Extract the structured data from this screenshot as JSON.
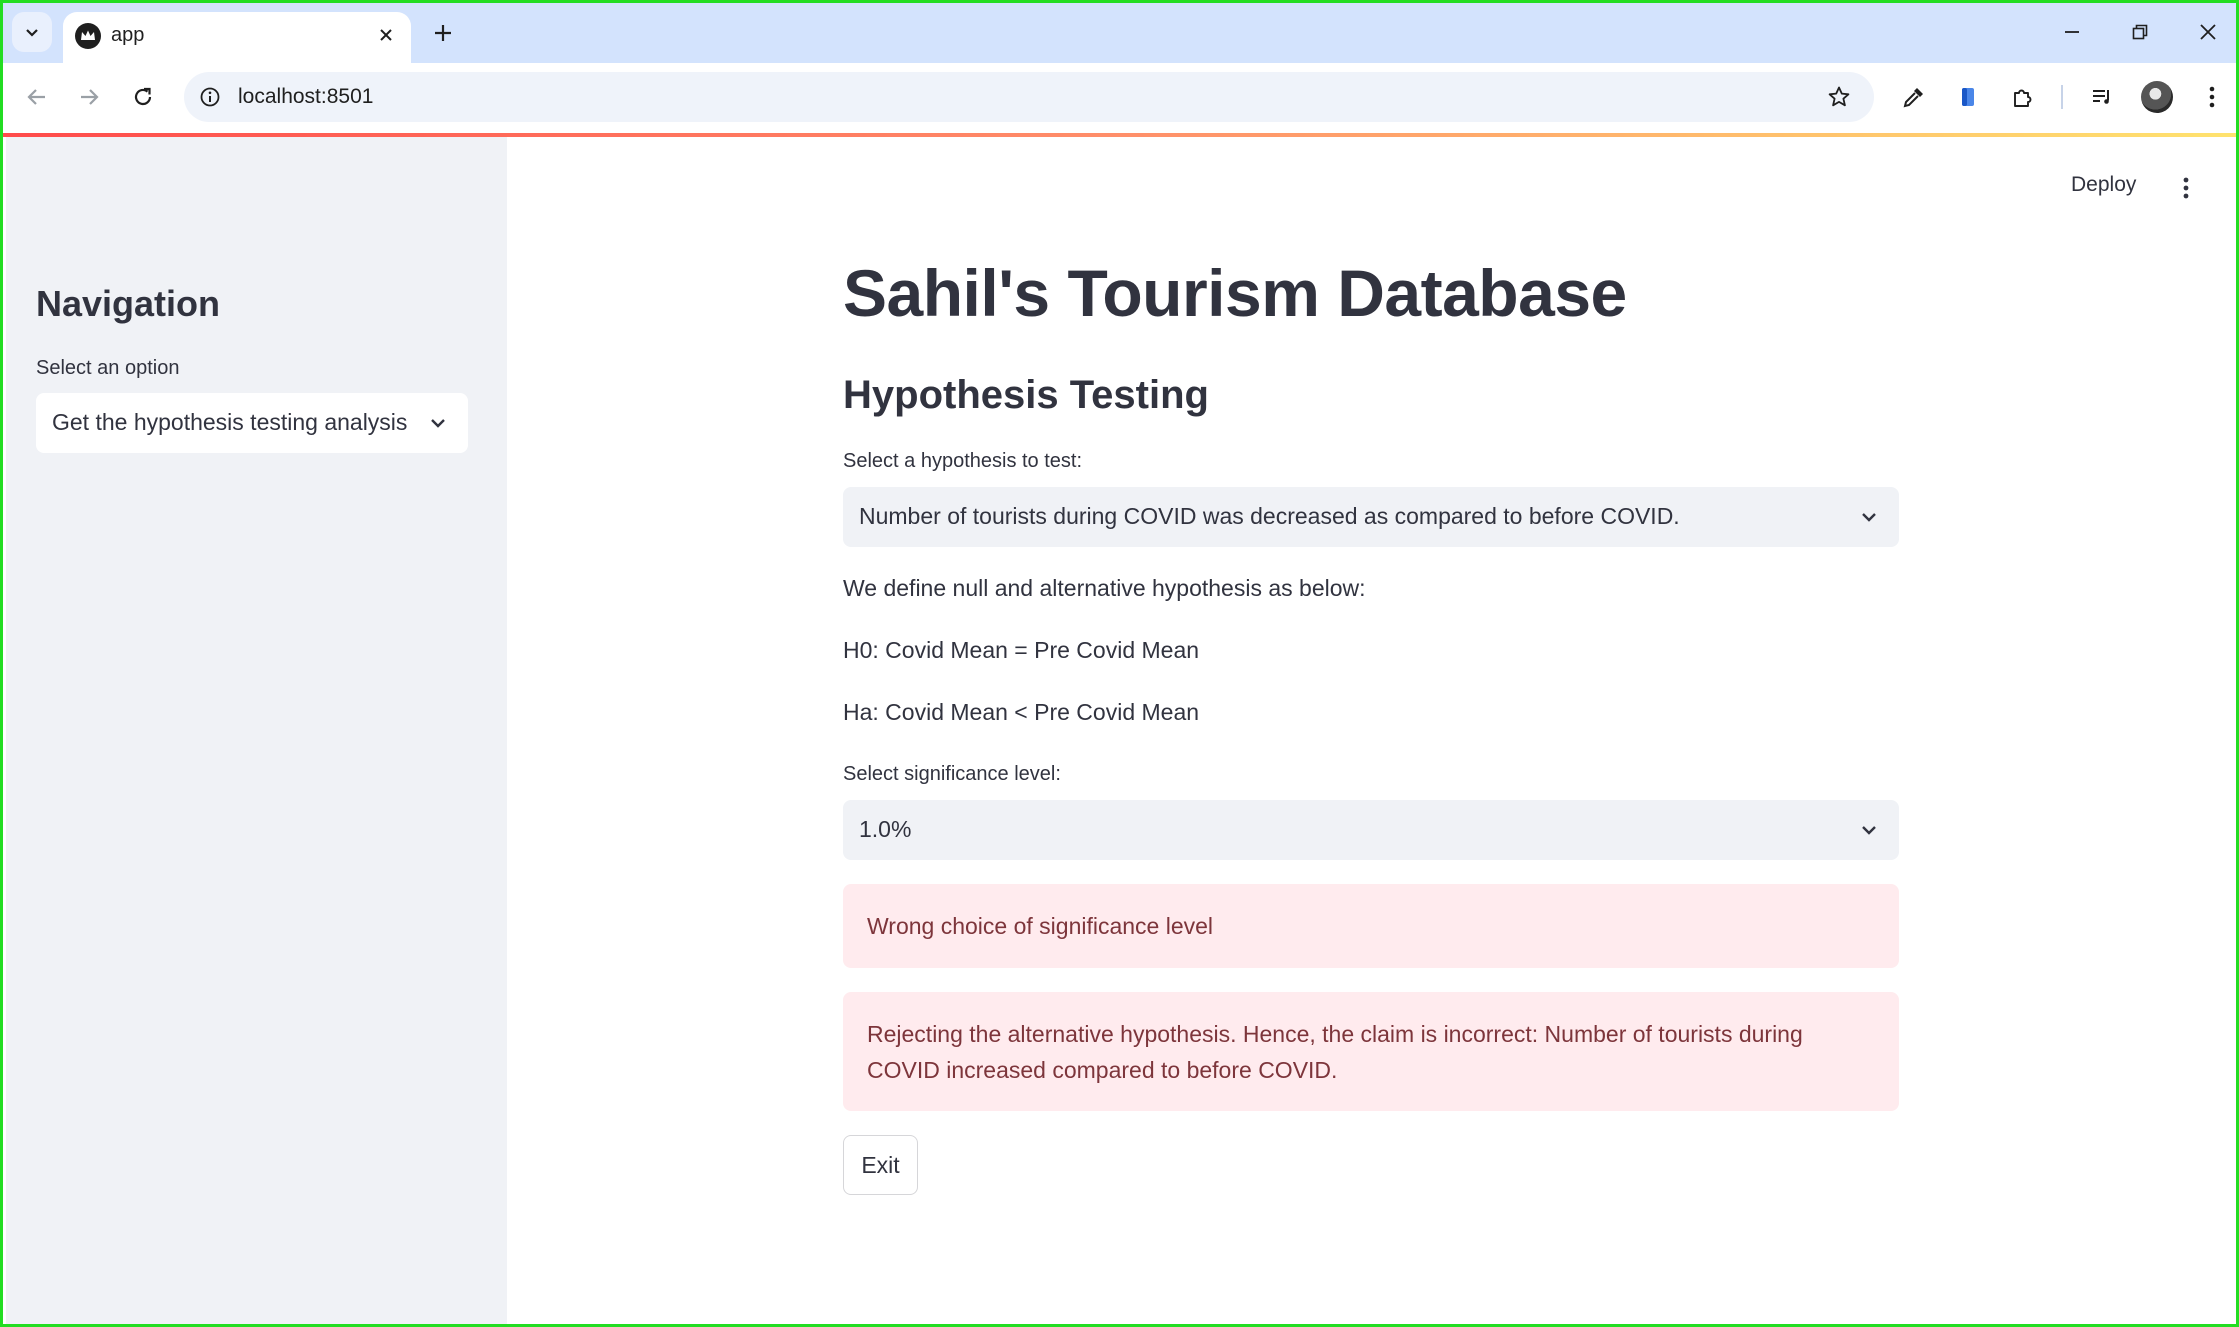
{
  "browser": {
    "tab_title": "app",
    "url": "localhost:8501"
  },
  "app": {
    "deploy_label": "Deploy",
    "sidebar": {
      "heading": "Navigation",
      "select_label": "Select an option",
      "select_value": "Get the hypothesis testing analysis"
    },
    "main": {
      "title": "Sahil's Tourism Database",
      "subheader": "Hypothesis Testing",
      "hypothesis_label": "Select a hypothesis to test:",
      "hypothesis_value": "Number of tourists during COVID was decreased as compared to before COVID.",
      "intro_text": "We define null and alternative hypothesis as below:",
      "h0_text": "H0: Covid Mean = Pre Covid Mean",
      "ha_text": "Ha: Covid Mean < Pre Covid Mean",
      "significance_label": "Select significance level:",
      "significance_value": "1.0%",
      "alert_wrong_choice": "Wrong choice of significance level",
      "alert_rejecting": "Rejecting the alternative hypothesis. Hence, the claim is incorrect: Number of tourists during COVID increased compared to before COVID.",
      "exit_label": "Exit"
    }
  },
  "colors": {
    "sidebar_bg": "#f0f2f6",
    "text": "#31333f",
    "error_bg": "#ffebee",
    "error_text": "#7d353b",
    "tabstrip_bg": "#d3e3fd",
    "accent": "#ff4b4b"
  },
  "icons": {
    "tab_search": "chevron-down-icon",
    "favicon": "streamlit-crown-icon",
    "tab_close": "close-icon",
    "new_tab": "plus-icon",
    "back": "arrow-left-icon",
    "forward": "arrow-right-icon",
    "reload": "reload-icon",
    "site_info": "info-icon",
    "bookmark": "star-icon",
    "eyedropper": "eyedropper-icon",
    "extension": "puzzle-icon",
    "media": "media-queue-icon",
    "menu": "kebab-icon"
  }
}
